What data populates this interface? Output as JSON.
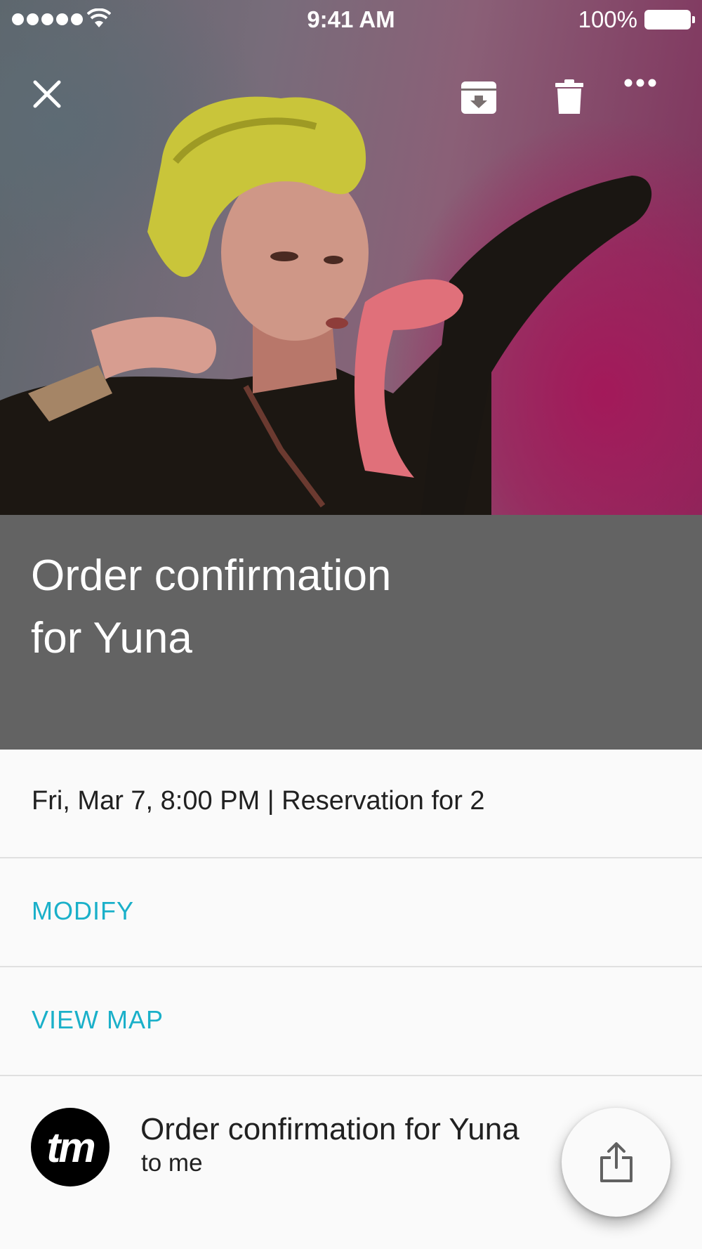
{
  "status_bar": {
    "time": "9:41 AM",
    "battery": "100%",
    "icons": [
      "signal-dots-icon",
      "wifi-icon",
      "battery-icon"
    ]
  },
  "toolbar": {
    "icons": [
      "close-icon",
      "archive-icon",
      "trash-icon",
      "more-icon"
    ]
  },
  "header": {
    "title": "Order confirmation for Yuna",
    "band_color": "#636363"
  },
  "details": {
    "datetime": "Fri, Mar 7, 8:00 PM | Reservation for 2"
  },
  "actions": {
    "modify": "MODIFY",
    "view_map": "VIEW MAP",
    "accent_color": "#1ab0c9"
  },
  "message": {
    "avatar_initials": "tm",
    "subject": "Order confirmation for Yuna",
    "to": "to me"
  },
  "fab": {
    "icon": "share-icon"
  }
}
